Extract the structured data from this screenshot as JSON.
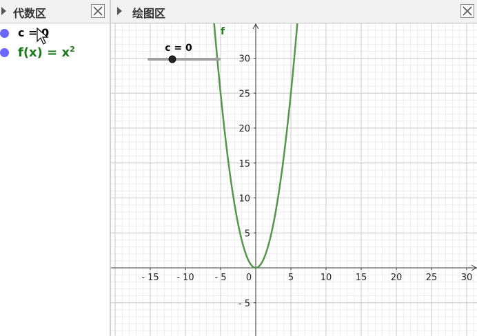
{
  "algebra": {
    "title": "代数区",
    "items": [
      {
        "label": "c = 0",
        "color": "#000000"
      },
      {
        "label": "f(x)  =  x",
        "sup": "2",
        "color": "#1a7a1a"
      }
    ]
  },
  "graphics": {
    "title": "绘图区",
    "function_label": "f",
    "slider": {
      "label": "c = 0",
      "value": 0
    },
    "colors": {
      "curve": "#54964a",
      "point": "#6a66ff"
    }
  },
  "chart_data": {
    "type": "line",
    "series": [
      {
        "name": "f",
        "expression": "x^2"
      }
    ],
    "x_ticks": [
      "- 15",
      "- 10",
      "- 5",
      "0",
      "5",
      "10",
      "15",
      "20",
      "25",
      "30"
    ],
    "y_ticks": [
      "30",
      "25",
      "20",
      "15",
      "10",
      "5",
      "- 5"
    ],
    "xlim": [
      -20,
      31
    ],
    "ylim": [
      -9,
      35
    ],
    "grid": true,
    "x_tick_values": [
      -15,
      -10,
      -5,
      0,
      5,
      10,
      15,
      20,
      25,
      30
    ],
    "y_tick_values": [
      30,
      25,
      20,
      15,
      10,
      5,
      -5
    ]
  }
}
